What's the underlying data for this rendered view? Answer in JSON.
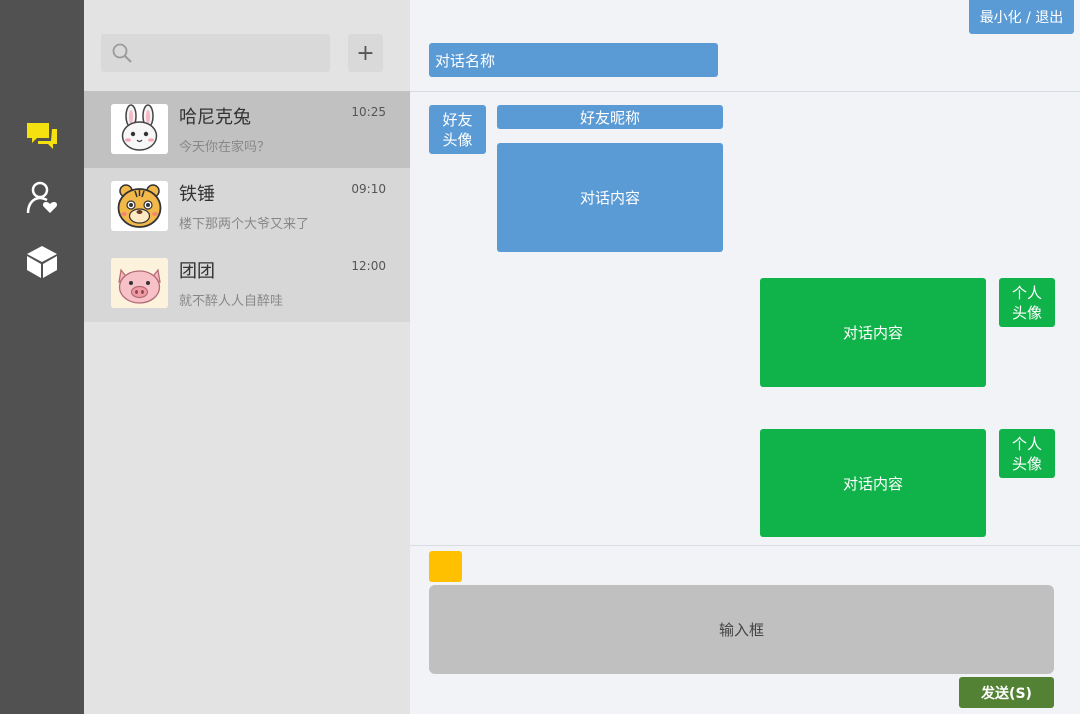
{
  "sidebar": {
    "icons": [
      "chat-bubbles-icon",
      "contacts-icon",
      "cube-icon"
    ],
    "active_color": "#f4e10f",
    "icon_color": "#ffffff"
  },
  "search": {
    "placeholder": "",
    "add_label": "+"
  },
  "contacts": [
    {
      "name": "哈尼克兔",
      "time": "10:25",
      "preview": "今天你在家吗？",
      "avatar": "rabbit-avatar-icon",
      "active": true
    },
    {
      "name": "铁锤",
      "time": "09:10",
      "preview": "楼下那两个大爷又来了",
      "avatar": "tiger-avatar-icon",
      "active": false
    },
    {
      "name": "团团",
      "time": "12:00",
      "preview": "就不醉人人自醉哇",
      "avatar": "pig-avatar-icon",
      "active": false
    }
  ],
  "chat": {
    "window_controls_label": "最小化 / 退出",
    "title": "对话名称",
    "friend_avatar_label": "好友\n头像",
    "friend_nickname": "好友昵称",
    "friend_message": "对话内容",
    "my_messages": [
      "对话内容",
      "对话内容"
    ],
    "my_avatar_label": "个人\n头像",
    "input_placeholder": "输入框",
    "send_label": "发送(S)"
  },
  "colors": {
    "blue": "#5b9bd5",
    "green": "#10b34a",
    "send": "#548235",
    "emoji": "#ffc000",
    "rail": "#515151"
  }
}
